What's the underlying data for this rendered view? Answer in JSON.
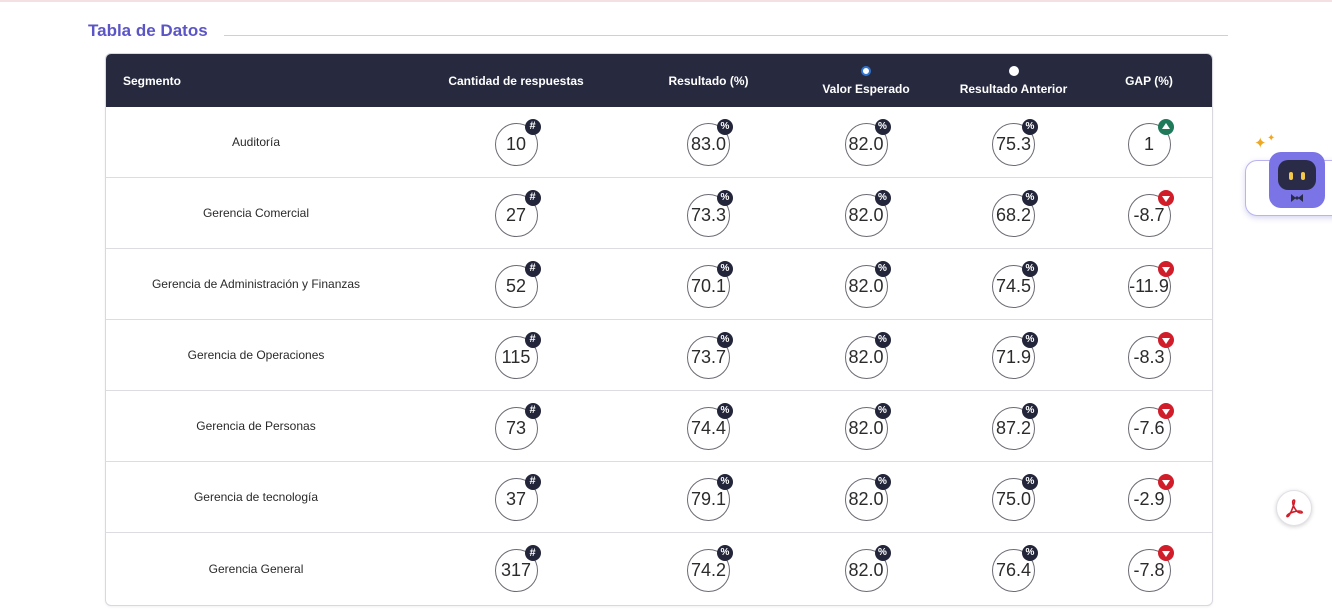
{
  "section": {
    "title": "Tabla de Datos"
  },
  "table": {
    "headers": {
      "segment": "Segmento",
      "count": "Cantidad de respuestas",
      "result": "Resultado (%)",
      "expected": "Valor Esperado",
      "previous": "Resultado Anterior",
      "gap": "GAP (%)"
    },
    "comparison_selected": "Valor Esperado",
    "badges": {
      "count": "#",
      "percent": "%"
    },
    "rows": [
      {
        "segment": "Auditoría",
        "count": "10",
        "result": "83.0",
        "expected": "82.0",
        "previous": "75.3",
        "gap": "1",
        "trend": "up"
      },
      {
        "segment": "Gerencia Comercial",
        "count": "27",
        "result": "73.3",
        "expected": "82.0",
        "previous": "68.2",
        "gap": "-8.7",
        "trend": "down"
      },
      {
        "segment": "Gerencia de Administración y Finanzas",
        "count": "52",
        "result": "70.1",
        "expected": "82.0",
        "previous": "74.5",
        "gap": "-11.9",
        "trend": "down"
      },
      {
        "segment": "Gerencia de Operaciones",
        "count": "115",
        "result": "73.7",
        "expected": "82.0",
        "previous": "71.9",
        "gap": "-8.3",
        "trend": "down"
      },
      {
        "segment": "Gerencia de Personas",
        "count": "73",
        "result": "74.4",
        "expected": "82.0",
        "previous": "87.2",
        "gap": "-7.6",
        "trend": "down"
      },
      {
        "segment": "Gerencia de tecnología",
        "count": "37",
        "result": "79.1",
        "expected": "82.0",
        "previous": "75.0",
        "gap": "-2.9",
        "trend": "down"
      },
      {
        "segment": "Gerencia General",
        "count": "317",
        "result": "74.2",
        "expected": "82.0",
        "previous": "76.4",
        "gap": "-7.8",
        "trend": "down"
      }
    ]
  },
  "icons": {
    "assistant": "robot-assistant-icon",
    "pdf": "pdf-export-icon",
    "trend_up": "triangle-up-icon",
    "trend_down": "triangle-down-icon"
  },
  "colors": {
    "title": "#5b55c6",
    "header_bg": "#272a3f",
    "badge_bg": "#23263a",
    "trend_up": "#1f7a5a",
    "trend_down": "#d11d2a",
    "radio_selected": "#2f74d0",
    "assistant": "#7a74e6",
    "pdf": "#d11d2a"
  }
}
